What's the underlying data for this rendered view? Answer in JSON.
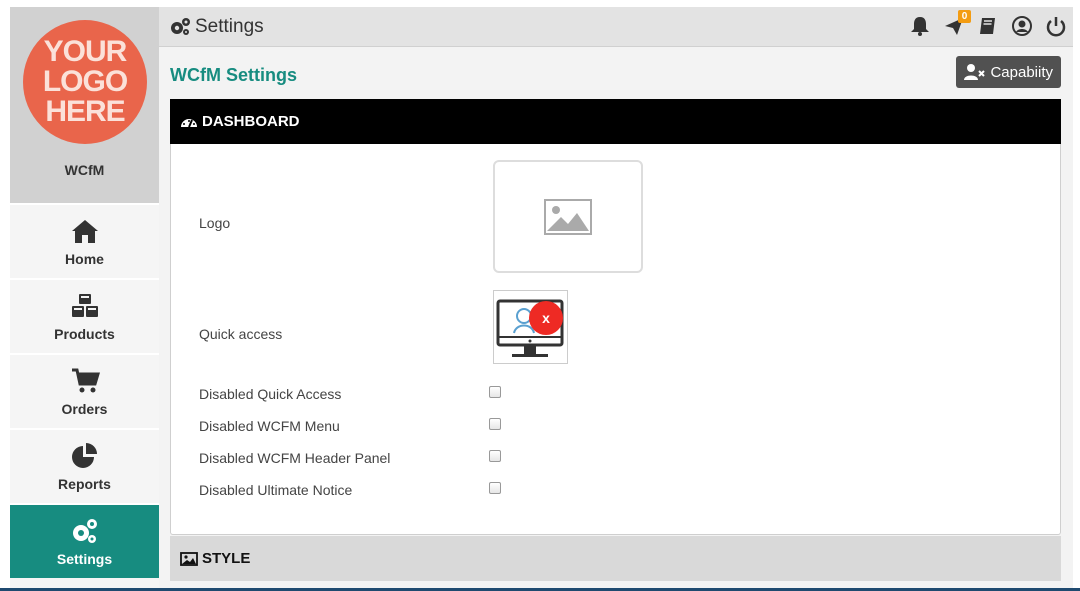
{
  "sidebar": {
    "logo_lines": [
      "YOUR",
      "LOGO",
      "HERE"
    ],
    "brand": "WCfM",
    "items": [
      {
        "label": "Home"
      },
      {
        "label": "Products"
      },
      {
        "label": "Orders"
      },
      {
        "label": "Reports"
      },
      {
        "label": "Settings",
        "active": true
      }
    ]
  },
  "header": {
    "title": "Settings",
    "notification_badge": "0"
  },
  "main": {
    "page_title": "WCfM Settings",
    "capability_button": "Capabiity",
    "dashboard_section": "DASHBOARD",
    "style_section": "STYLE",
    "fields": {
      "logo": "Logo",
      "quick_access": "Quick access",
      "quick_access_remove": "x",
      "disabled_quick_access": "Disabled Quick Access",
      "disabled_wcfm_menu": "Disabled WCFM Menu",
      "disabled_header_panel": "Disabled WCFM Header Panel",
      "disabled_ultimate_notice": "Disabled Ultimate Notice"
    }
  },
  "colors": {
    "accent": "#178c80",
    "logo_bg": "#e9654b",
    "dark_header": "#000000",
    "badge": "#f39c12",
    "remove": "#ee2a24"
  }
}
